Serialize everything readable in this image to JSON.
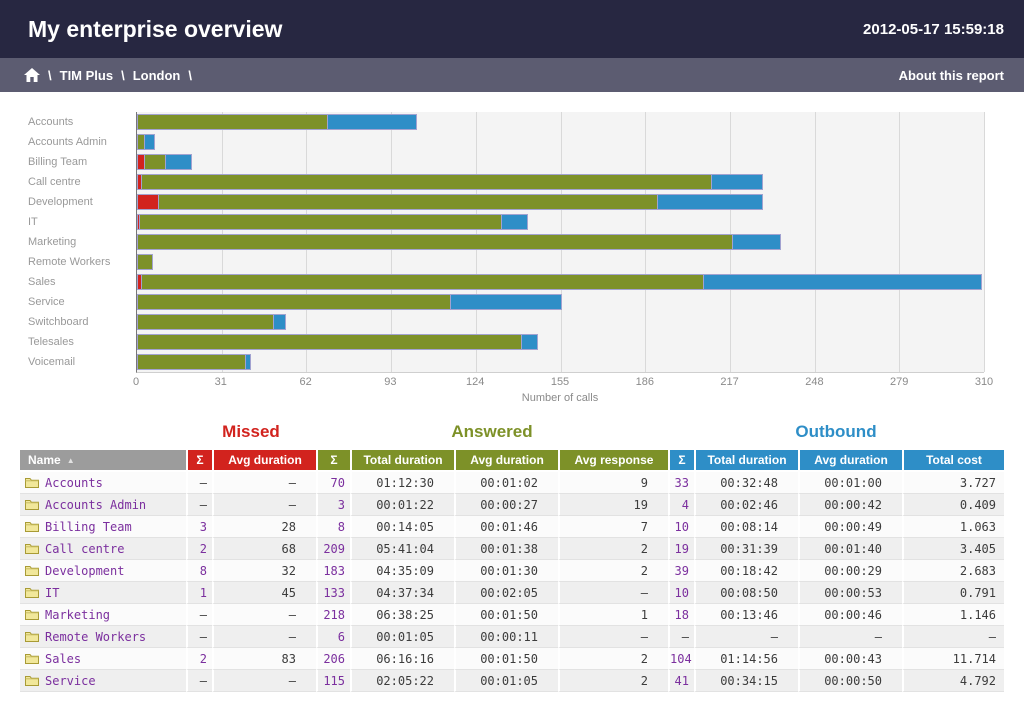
{
  "title_bar": {
    "title": "My enterprise overview",
    "timestamp": "2012-05-17 15:59:18"
  },
  "breadcrumb": {
    "separator": "\\",
    "items": [
      "TIM Plus",
      "London"
    ],
    "about_link": "About this report"
  },
  "colors": {
    "header_bg": "#272741",
    "breadcrumb_bg": "#5c5c71",
    "missed": "#d2231e",
    "answered": "#7d9128",
    "outbound": "#2e8ec7",
    "link_purple": "#7b2f9e",
    "name_header_bg": "#9c9c9c"
  },
  "chart_data": {
    "type": "bar",
    "orientation": "horizontal",
    "stacked": true,
    "categories": [
      "Accounts",
      "Accounts Admin",
      "Billing Team",
      "Call centre",
      "Development",
      "IT",
      "Marketing",
      "Remote Workers",
      "Sales",
      "Service",
      "Switchboard",
      "Telesales",
      "Voicemail"
    ],
    "series": [
      {
        "name": "Missed",
        "color": "#d2231e",
        "values": [
          0,
          0,
          3,
          2,
          8,
          1,
          0,
          0,
          2,
          0,
          0,
          0,
          0
        ]
      },
      {
        "name": "Answered",
        "color": "#7d9128",
        "values": [
          70,
          3,
          8,
          209,
          183,
          133,
          218,
          6,
          206,
          115,
          50,
          141,
          40
        ]
      },
      {
        "name": "Outbound",
        "color": "#2e8ec7",
        "values": [
          33,
          4,
          10,
          19,
          39,
          10,
          18,
          0,
          104,
          41,
          5,
          6,
          2
        ]
      }
    ],
    "xlabel": "Number of calls",
    "xlim": [
      0,
      310
    ],
    "xticks": [
      0,
      31,
      62,
      93,
      124,
      155,
      186,
      217,
      248,
      279,
      310
    ],
    "grid": true,
    "legend": false
  },
  "table": {
    "groups": [
      {
        "label": "Missed"
      },
      {
        "label": "Answered"
      },
      {
        "label": "Outbound"
      }
    ],
    "columns": {
      "name": "Name",
      "sort_indicator": "▲",
      "missed_sum": "Σ",
      "missed_avg": "Avg duration",
      "ans_sum": "Σ",
      "ans_total": "Total duration",
      "ans_avg": "Avg duration",
      "ans_resp": "Avg response",
      "out_sum": "Σ",
      "out_total": "Total duration",
      "out_avg": "Avg duration",
      "cost": "Total cost"
    },
    "rows": [
      {
        "name": "Accounts",
        "missed_sum": "–",
        "missed_avg": "–",
        "ans_sum": "70",
        "ans_total": "01:12:30",
        "ans_avg": "00:01:02",
        "ans_resp": "9",
        "out_sum": "33",
        "out_total": "00:32:48",
        "out_avg": "00:01:00",
        "cost": "3.727"
      },
      {
        "name": "Accounts Admin",
        "missed_sum": "–",
        "missed_avg": "–",
        "ans_sum": "3",
        "ans_total": "00:01:22",
        "ans_avg": "00:00:27",
        "ans_resp": "19",
        "out_sum": "4",
        "out_total": "00:02:46",
        "out_avg": "00:00:42",
        "cost": "0.409"
      },
      {
        "name": "Billing Team",
        "missed_sum": "3",
        "missed_avg": "28",
        "ans_sum": "8",
        "ans_total": "00:14:05",
        "ans_avg": "00:01:46",
        "ans_resp": "7",
        "out_sum": "10",
        "out_total": "00:08:14",
        "out_avg": "00:00:49",
        "cost": "1.063"
      },
      {
        "name": "Call centre",
        "missed_sum": "2",
        "missed_avg": "68",
        "ans_sum": "209",
        "ans_total": "05:41:04",
        "ans_avg": "00:01:38",
        "ans_resp": "2",
        "out_sum": "19",
        "out_total": "00:31:39",
        "out_avg": "00:01:40",
        "cost": "3.405"
      },
      {
        "name": "Development",
        "missed_sum": "8",
        "missed_avg": "32",
        "ans_sum": "183",
        "ans_total": "04:35:09",
        "ans_avg": "00:01:30",
        "ans_resp": "2",
        "out_sum": "39",
        "out_total": "00:18:42",
        "out_avg": "00:00:29",
        "cost": "2.683"
      },
      {
        "name": "IT",
        "missed_sum": "1",
        "missed_avg": "45",
        "ans_sum": "133",
        "ans_total": "04:37:34",
        "ans_avg": "00:02:05",
        "ans_resp": "–",
        "out_sum": "10",
        "out_total": "00:08:50",
        "out_avg": "00:00:53",
        "cost": "0.791"
      },
      {
        "name": "Marketing",
        "missed_sum": "–",
        "missed_avg": "–",
        "ans_sum": "218",
        "ans_total": "06:38:25",
        "ans_avg": "00:01:50",
        "ans_resp": "1",
        "out_sum": "18",
        "out_total": "00:13:46",
        "out_avg": "00:00:46",
        "cost": "1.146"
      },
      {
        "name": "Remote Workers",
        "missed_sum": "–",
        "missed_avg": "–",
        "ans_sum": "6",
        "ans_total": "00:01:05",
        "ans_avg": "00:00:11",
        "ans_resp": "–",
        "out_sum": "–",
        "out_total": "–",
        "out_avg": "–",
        "cost": "–"
      },
      {
        "name": "Sales",
        "missed_sum": "2",
        "missed_avg": "83",
        "ans_sum": "206",
        "ans_total": "06:16:16",
        "ans_avg": "00:01:50",
        "ans_resp": "2",
        "out_sum": "104",
        "out_total": "01:14:56",
        "out_avg": "00:00:43",
        "cost": "11.714"
      },
      {
        "name": "Service",
        "missed_sum": "–",
        "missed_avg": "–",
        "ans_sum": "115",
        "ans_total": "02:05:22",
        "ans_avg": "00:01:05",
        "ans_resp": "2",
        "out_sum": "41",
        "out_total": "00:34:15",
        "out_avg": "00:00:50",
        "cost": "4.792"
      }
    ]
  }
}
